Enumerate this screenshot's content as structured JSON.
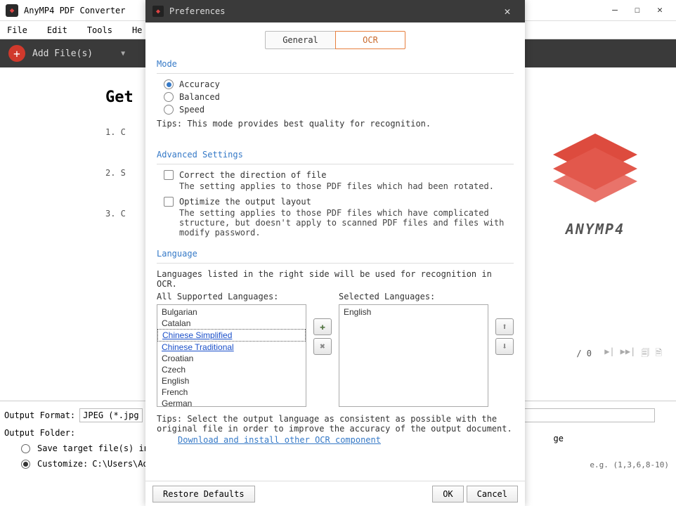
{
  "main": {
    "title": "AnyMP4 PDF Converter",
    "menu": {
      "file": "File",
      "edit": "Edit",
      "tools": "Tools",
      "help": "He"
    },
    "addFiles": "Add File(s)",
    "getStarted": "Get",
    "steps": {
      "s1": "1. C",
      "s2": "2. S",
      "s3": "3. C"
    },
    "brand": "ANYMP4",
    "pageInfo": "/ 0",
    "outputFormatLabel": "Output Format:",
    "outputFormatValue": "JPEG (*.jpg)",
    "outputFolderLabel": "Output Folder:",
    "saveTargetLabel": "Save target file(s) in s",
    "customizeLabel": "Customize:",
    "customizePath": "C:\\Users\\Admi",
    "rangeLabel": "ge",
    "rangeHint": "e.g. (1,3,6,8-10)"
  },
  "prefs": {
    "title": "Preferences",
    "tabs": {
      "general": "General",
      "ocr": "OCR"
    },
    "mode": {
      "label": "Mode",
      "options": {
        "accuracy": "Accuracy",
        "balanced": "Balanced",
        "speed": "Speed"
      },
      "tip": "Tips: This mode provides best quality for recognition."
    },
    "advanced": {
      "label": "Advanced Settings",
      "correct": "Correct the direction of file",
      "correctNote": "The setting applies to those PDF files which had been rotated.",
      "optimize": "Optimize the output layout",
      "optimizeNote": "The setting applies to those PDF files which have complicated structure, but doesn't apply to scanned PDF files and files with modify password."
    },
    "language": {
      "label": "Language",
      "note": "Languages listed in the right side will be used for recognition in OCR.",
      "allHead": "All Supported Languages:",
      "selHead": "Selected Languages:",
      "all": [
        "Bulgarian",
        "Catalan",
        "Chinese Simplified",
        "Chinese Traditional",
        "Croatian",
        "Czech",
        "English",
        "French",
        "German"
      ],
      "selected": [
        "English"
      ],
      "tip": "Tips: Select the output language as consistent as possible with the original file in order to improve the accuracy of the output document.",
      "download": "Download and install other OCR component"
    },
    "buttons": {
      "restore": "Restore Defaults",
      "ok": "OK",
      "cancel": "Cancel"
    }
  }
}
